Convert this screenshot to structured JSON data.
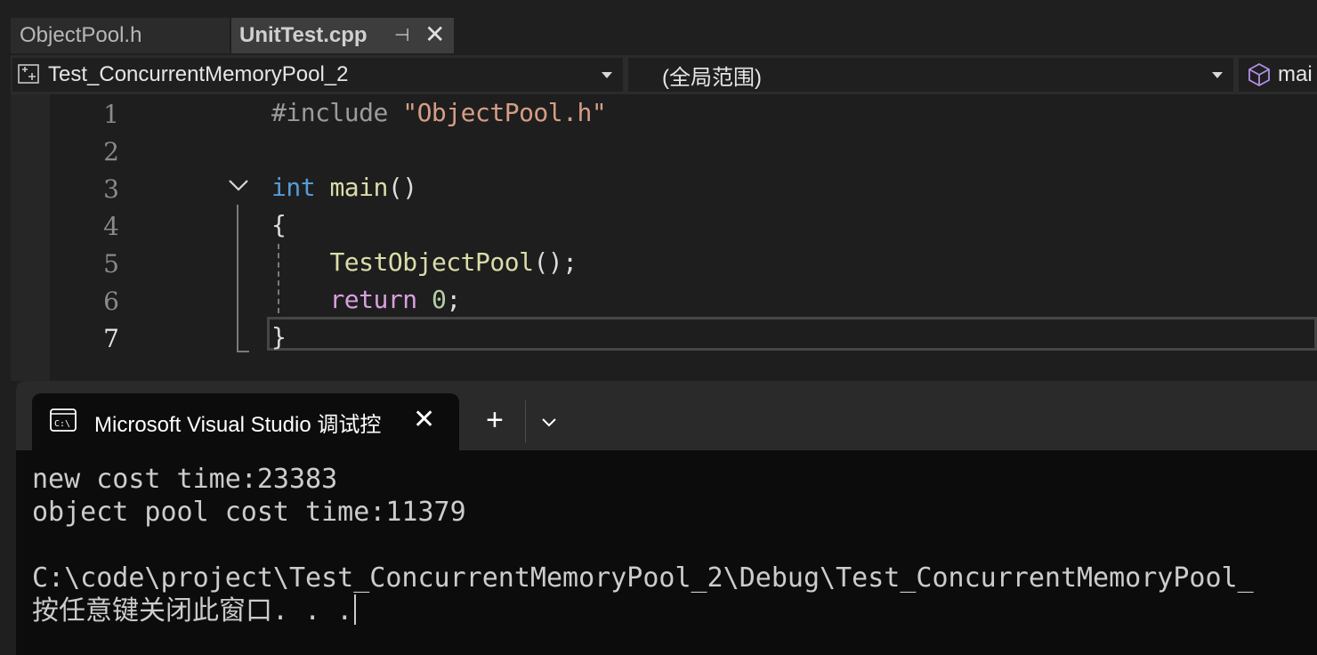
{
  "editor_tabs": [
    {
      "label": "ObjectPool.h",
      "active": false
    },
    {
      "label": "UnitTest.cpp",
      "active": true
    }
  ],
  "tab_pin_glyph": "⊣",
  "tab_close_glyph": "✕",
  "navbar": {
    "project": "Test_ConcurrentMemoryPool_2",
    "scope": "(全局范围)",
    "member": "mai"
  },
  "code_lines": [
    {
      "num": "1"
    },
    {
      "num": "2"
    },
    {
      "num": "3"
    },
    {
      "num": "4"
    },
    {
      "num": "5"
    },
    {
      "num": "6"
    },
    {
      "num": "7"
    }
  ],
  "code": {
    "l1_directive": "#include",
    "l1_string": "\"ObjectPool.h\"",
    "l3_type": "int",
    "l3_name": "main",
    "l3_parens": "()",
    "l4_brace": "{",
    "l5_call": "TestObjectPool",
    "l5_rest": "();",
    "l6_keyword": "return",
    "l6_value": "0",
    "l6_semi": ";",
    "l7_brace": "}"
  },
  "console": {
    "tab_title": "Microsoft Visual Studio 调试控",
    "close_glyph": "✕",
    "new_tab_glyph": "+",
    "lines": [
      "new cost time:23383",
      "object pool cost time:11379",
      "",
      "C:\\code\\project\\Test_ConcurrentMemoryPool_2\\Debug\\Test_ConcurrentMemoryPool_",
      "按任意键关闭此窗口. . ."
    ]
  },
  "colors": {
    "keyword": "#569cd6",
    "function": "#dcdcaa",
    "string": "#d69d85",
    "control": "#d8a0df",
    "number": "#b5cea8"
  },
  "icons": [
    "class-icon",
    "dropdown-arrow-icon",
    "cube-icon",
    "fold-chevron-icon",
    "terminal-icon",
    "chevron-down-icon"
  ]
}
